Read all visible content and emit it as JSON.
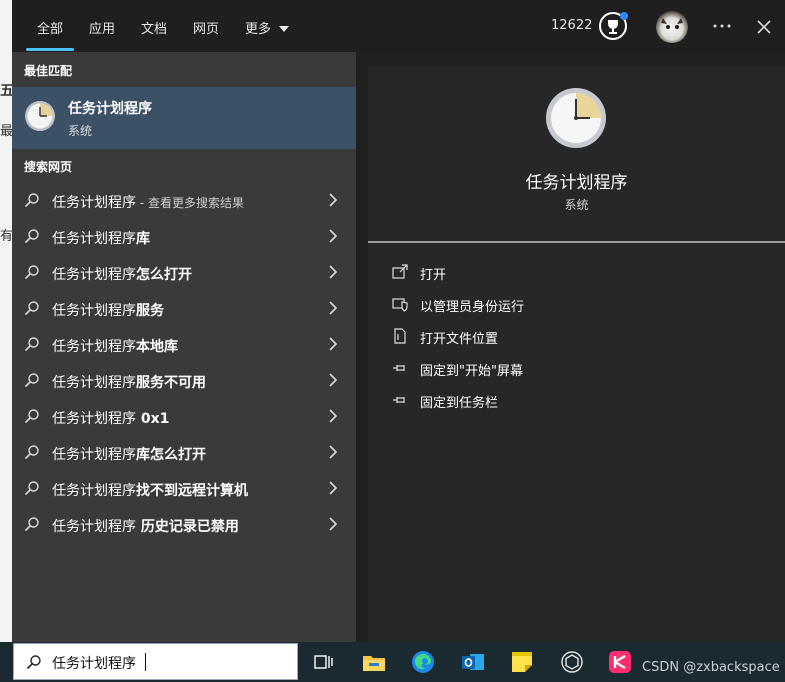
{
  "tabs": [
    {
      "label": "全部"
    },
    {
      "label": "应用"
    },
    {
      "label": "文档"
    },
    {
      "label": "网页"
    },
    {
      "label": "更多"
    }
  ],
  "header": {
    "points": "12622"
  },
  "best_match": {
    "heading": "最佳匹配",
    "title": "任务计划程序",
    "subtitle": "系统"
  },
  "web": {
    "heading": "搜索网页",
    "items": [
      {
        "prefix": "任务计划程序",
        "bold": "",
        "sub": " - 查看更多搜索结果"
      },
      {
        "prefix": "任务计划程序",
        "bold": "库",
        "sub": ""
      },
      {
        "prefix": "任务计划程序",
        "bold": "怎么打开",
        "sub": ""
      },
      {
        "prefix": "任务计划程序",
        "bold": "服务",
        "sub": ""
      },
      {
        "prefix": "任务计划程序",
        "bold": "本地库",
        "sub": ""
      },
      {
        "prefix": "任务计划程序",
        "bold": "服务不可用",
        "sub": ""
      },
      {
        "prefix": "任务计划程序",
        "bold": " 0x1",
        "sub": ""
      },
      {
        "prefix": "任务计划程序",
        "bold": "库怎么打开",
        "sub": ""
      },
      {
        "prefix": "任务计划程序",
        "bold": "找不到远程计算机",
        "sub": ""
      },
      {
        "prefix": "任务计划程序",
        "bold": " 历史记录已禁用",
        "sub": ""
      }
    ]
  },
  "detail": {
    "title": "任务计划程序",
    "subtitle": "系统",
    "actions": [
      {
        "label": "打开",
        "icon": "open-icon"
      },
      {
        "label": "以管理员身份运行",
        "icon": "shield-icon"
      },
      {
        "label": "打开文件位置",
        "icon": "file-location-icon"
      },
      {
        "label": "固定到\"开始\"屏幕",
        "icon": "pin-icon"
      },
      {
        "label": "固定到任务栏",
        "icon": "pin-icon"
      }
    ]
  },
  "search": {
    "value": "任务计划程序"
  },
  "watermark": "CSDN @zxbackspace",
  "colors": {
    "accent": "#4cc2ff",
    "selected": "#3d5166"
  }
}
